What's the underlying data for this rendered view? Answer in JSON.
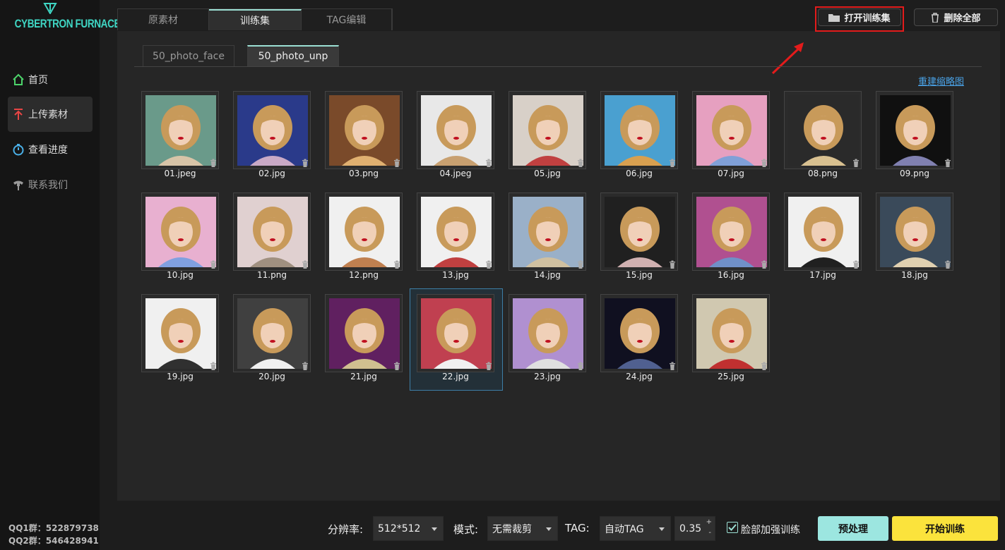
{
  "app": {
    "logo_text": "CYBERTRON FURNACE"
  },
  "sidebar": {
    "items": [
      {
        "label": "首页",
        "icon": "home-icon"
      },
      {
        "label": "上传素材",
        "icon": "upload-icon"
      },
      {
        "label": "查看进度",
        "icon": "stopwatch-icon"
      },
      {
        "label": "联系我们",
        "icon": "contact-icon"
      }
    ],
    "qq1": "QQ1群：522879738",
    "qq2": "QQ2群：546428941"
  },
  "top_tabs": [
    {
      "label": "原素材"
    },
    {
      "label": "训练集",
      "active": true
    },
    {
      "label": "TAG编辑"
    }
  ],
  "toolbar": {
    "open_label": "打开训练集",
    "delete_label": "删除全部"
  },
  "sub_tabs": [
    {
      "label": "50_photo_face"
    },
    {
      "label": "50_photo_unp",
      "active": true
    }
  ],
  "rebuild_label": "重建缩略图",
  "images": [
    {
      "name": "01.jpeg"
    },
    {
      "name": "02.jpg"
    },
    {
      "name": "03.png"
    },
    {
      "name": "04.jpeg"
    },
    {
      "name": "05.jpg"
    },
    {
      "name": "06.jpg"
    },
    {
      "name": "07.jpg"
    },
    {
      "name": "08.png"
    },
    {
      "name": "09.png"
    },
    {
      "name": "10.jpg"
    },
    {
      "name": "11.png"
    },
    {
      "name": "12.png"
    },
    {
      "name": "13.jpg"
    },
    {
      "name": "14.jpg"
    },
    {
      "name": "15.jpg"
    },
    {
      "name": "16.jpg"
    },
    {
      "name": "17.jpg"
    },
    {
      "name": "18.jpg"
    },
    {
      "name": "19.jpg"
    },
    {
      "name": "20.jpg"
    },
    {
      "name": "21.jpg"
    },
    {
      "name": "22.jpg"
    },
    {
      "name": "23.jpg"
    },
    {
      "name": "24.jpg"
    },
    {
      "name": "25.jpg"
    }
  ],
  "selected_image": "22.jpg",
  "bottom": {
    "resolution_label": "分辨率:",
    "resolution_value": "512*512",
    "mode_label": "模式:",
    "mode_value": "无需裁剪",
    "tag_label": "TAG:",
    "tag_value": "自动TAG",
    "threshold_value": "0.35",
    "face_enhance_label": "脸部加强训练",
    "face_enhance_checked": true,
    "preprocess_label": "预处理",
    "start_label": "开始训练"
  },
  "colors": {
    "accent": "#9ce0d4",
    "start_button": "#fbe33c",
    "preprocess_button": "#9ce6e0",
    "highlight": "#e31b1b",
    "link": "#4aa3e8"
  }
}
